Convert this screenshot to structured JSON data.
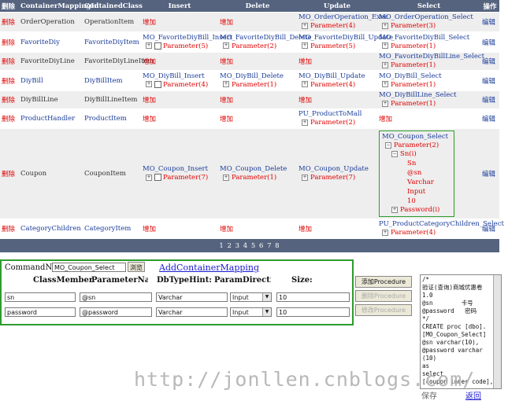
{
  "headers": [
    "删除",
    "ContainerMappingId",
    "ContainedClass",
    "Insert",
    "Delete",
    "Update",
    "Select",
    "操作"
  ],
  "rows": [
    {
      "del": "删除",
      "id": "OrderOperation",
      "cls": "OperationItem",
      "ins": {
        "add": "增加"
      },
      "dl": {
        "add": "增加"
      },
      "upd": {
        "name": "MO_OrderOperation_Exec",
        "param": "Parameter(4)"
      },
      "sel": {
        "name": "MO_OrderOperation_Select",
        "param": "Parameter(3)"
      },
      "op": "编辑"
    },
    {
      "del": "删除",
      "id": "FavoriteDiy",
      "cls": "FavoriteDiyItem",
      "ins": {
        "name": "MO_FavoriteDiyBill_Insert",
        "param": "Parameter(5)"
      },
      "dl": {
        "name": "MO_FavoriteDiyBill_Delete",
        "param": "Parameter(2)"
      },
      "upd": {
        "name": "MO_FavoriteDiyBill_Update",
        "param": "Parameter(5)"
      },
      "sel": {
        "name": "MO_FavoriteDiyBill_Select",
        "param": "Parameter(1)"
      },
      "op": "编辑"
    },
    {
      "del": "删除",
      "id": "FavoriteDiyLine",
      "cls": "FavoriteDiyLineItem",
      "ins": {
        "add": "增加"
      },
      "dl": {
        "add": "增加"
      },
      "upd": {
        "add": "增加"
      },
      "sel": {
        "name": "MO_FavoriteDiyBillLine_Select",
        "param": "Parameter(1)"
      },
      "op": "编辑"
    },
    {
      "del": "删除",
      "id": "DiyBill",
      "cls": "DiyBillItem",
      "ins": {
        "name": "MO_DiyBill_Insert",
        "param": "Parameter(4)"
      },
      "dl": {
        "name": "MO_DiyBill_Delete",
        "param": "Parameter(1)"
      },
      "upd": {
        "name": "MO_DiyBill_Update",
        "param": "Parameter(4)"
      },
      "sel": {
        "name": "MO_DiyBill_Select",
        "param": "Parameter(1)"
      },
      "op": "编辑"
    },
    {
      "del": "删除",
      "id": "DiyBillLine",
      "cls": "DiyBillLineItem",
      "ins": {
        "add": "增加"
      },
      "dl": {
        "add": "增加"
      },
      "upd": {
        "add": "增加"
      },
      "sel": {
        "name": "MO_DiyBillLine_Select",
        "param": "Parameter(1)"
      },
      "op": "编辑"
    },
    {
      "del": "删除",
      "id": "ProductHandler",
      "cls": "ProductItem",
      "ins": {
        "add": "增加"
      },
      "dl": {
        "add": "增加"
      },
      "upd": {
        "name": "PU_ProductToMall",
        "param": "Parameter(2)"
      },
      "sel": {
        "add": "增加"
      },
      "op": "编辑"
    },
    {
      "del": "删除",
      "id": "Coupon",
      "cls": "CouponItem",
      "ins": {
        "name": "MO_Coupon_Insert",
        "param": "Parameter(7)"
      },
      "dl": {
        "name": "MO_Coupon_Delete",
        "param": "Parameter(1)"
      },
      "upd": {
        "name": "MO_Coupon_Update",
        "param": "Parameter(7)"
      },
      "sel": {
        "name": "MO_Coupon_Select",
        "param": "Parameter(2)",
        "tree": {
          "node": "Sn(i)",
          "leaves": [
            "Sn",
            "@sn",
            "Varchar",
            "Input",
            "10"
          ],
          "node2": "Password(i)"
        }
      },
      "op": "编辑"
    },
    {
      "del": "删除",
      "id": "CategoryChildren",
      "cls": "CategoryItem",
      "ins": {
        "add": "增加"
      },
      "dl": {
        "add": "增加"
      },
      "upd": {
        "add": "增加"
      },
      "sel": {
        "name": "PU_ProductCategoryChildren_Select",
        "param": "Parameter(4)"
      },
      "op": "编辑"
    }
  ],
  "pager": "1 2 3 4 5 6 7 8",
  "form": {
    "command_label": "CommandNar",
    "command_value": "MO_Coupon_Select",
    "browse_btn": "浏览",
    "add_mapping": "AddContainerMapping",
    "col_headers": [
      "ClassMember",
      "ParameterNan",
      "DbTypeHint:",
      "ParamDirectio",
      "Size:"
    ],
    "params": [
      {
        "member": "sn",
        "pname": "@sn",
        "dbtype": "Varchar",
        "dir": "Input",
        "size": "10"
      },
      {
        "member": "password",
        "pname": "@password",
        "dbtype": "Varchar",
        "dir": "Input",
        "size": "10"
      }
    ]
  },
  "buttons": {
    "add": "添加Procedure",
    "del": "删除Procedure",
    "mod": "修改Procedure"
  },
  "sql_text": "/*\n验证(查询)商城优惠卷\n1.0\n@sn        卡号\n@password   密码\n*/\nCREATE proc [dbo].\n[MO_Coupon_Select]\n@sn varchar(10),\n@password varchar\n(10)\nas\nselect\n[coupon inner code],",
  "footer": {
    "save": "保存",
    "back": "返回"
  },
  "watermark": "http://jonllen.cnblogs.com/"
}
